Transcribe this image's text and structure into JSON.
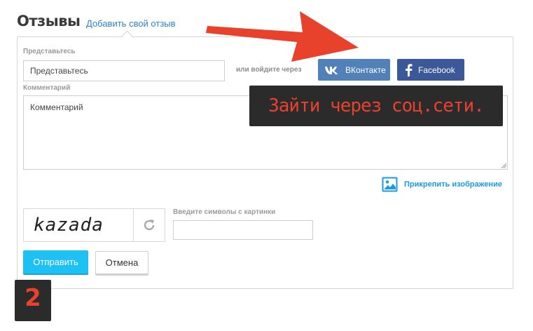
{
  "header": {
    "title": "Отзывы",
    "add_review_link": "Добавить свой отзыв"
  },
  "form": {
    "name_label": "Представьтесь",
    "name_placeholder": "Представьтесь",
    "or_login_text": "или войдите через",
    "vk_button": "ВКонтакте",
    "fb_button": "Facebook",
    "comment_label": "Комментарий",
    "comment_placeholder": "Комментарий",
    "attach_image": "Прикрепить изображение",
    "captcha_text": "kazada",
    "captcha_label": "Введите символы с картинки",
    "submit_button": "Отправить",
    "cancel_button": "Отмена"
  },
  "annotations": {
    "tooltip_text": "Зайти через соц.сети.",
    "step_number": "2"
  },
  "colors": {
    "vk": "#5181b8",
    "facebook": "#3b5998",
    "submit": "#1ec1f4",
    "arrow": "#e8412c",
    "link": "#2f7fd0"
  }
}
